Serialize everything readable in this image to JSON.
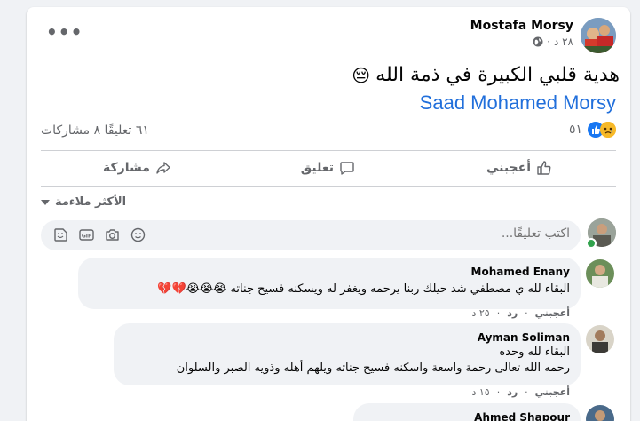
{
  "post": {
    "author": "Mostafa Morsy",
    "time": "٢٨ د",
    "separator": "·",
    "text": "هدية قلبي الكبيرة في ذمة الله",
    "text_emoji": "😔",
    "mention": "Saad Mohamed Morsy",
    "reactions_count": "٥١",
    "comments_shares": "٦١ تعليقًا  ٨ مشاركات"
  },
  "actions": {
    "like": "أعجبني",
    "comment": "تعليق",
    "share": "مشاركة"
  },
  "sort_label": "الأكثر ملاءمة",
  "composer": {
    "placeholder": "اكتب تعليقًا..."
  },
  "comments": [
    {
      "author": "Mohamed Enany",
      "lines": [
        "البقاء لله ي مصطفي شد حيلك ربنا يرحمه ويغفر له ويسكنه فسيح جناته 😭😭😭💔💔"
      ],
      "like": "أعجبني",
      "reply": "رد",
      "time": "٢٥ د"
    },
    {
      "author": "Ayman Soliman",
      "lines": [
        "البقاء لله وحده",
        "رحمه الله تعالى رحمة واسعة واسكنه فسيح جناته ويلهم أهله وذويه الصبر والسلوان"
      ],
      "like": "أعجبني",
      "reply": "رد",
      "time": "١٥ د"
    },
    {
      "author": "Ahmed Shapour",
      "lines": [],
      "like": "",
      "reply": "",
      "time": ""
    }
  ],
  "colors": {
    "brand_blue": "#216fdb",
    "online_green": "#31a24c",
    "meta_gray": "#65676b"
  }
}
